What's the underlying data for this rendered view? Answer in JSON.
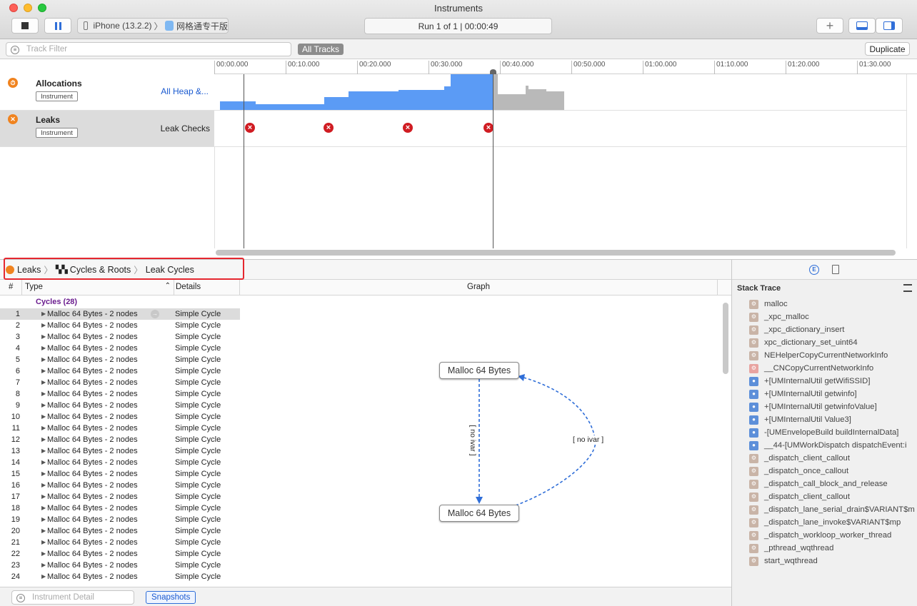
{
  "window": {
    "title": "Instruments"
  },
  "toolbar": {
    "device_name": "iPhone (13.2.2)",
    "app_name": "网格通专干版",
    "run_status": "Run 1 of 1  |  00:00:49"
  },
  "filterbar": {
    "track_filter_placeholder": "Track Filter",
    "all_tracks_label": "All Tracks",
    "duplicate_label": "Duplicate"
  },
  "ruler": {
    "ticks": [
      "00:00.000",
      "00:10.000",
      "00:20.000",
      "00:30.000",
      "00:40.000",
      "00:50.000",
      "01:00.000",
      "01:10.000",
      "01:20.000",
      "01:30.000"
    ]
  },
  "tracks": [
    {
      "name": "Allocations",
      "badge": "Instrument",
      "detail": "All Heap &..."
    },
    {
      "name": "Leaks",
      "badge": "Instrument",
      "detail": "Leak Checks"
    }
  ],
  "breadcrumb": {
    "items": [
      "Leaks",
      "Cycles & Roots",
      "Leak Cycles"
    ]
  },
  "columns": {
    "num": "#",
    "type": "Type",
    "details": "Details",
    "graph": "Graph"
  },
  "cycles": {
    "group_label": "Cycles (28)",
    "rows": [
      {
        "n": "1",
        "type": "Malloc 64 Bytes - 2 nodes",
        "details": "Simple Cycle"
      },
      {
        "n": "2",
        "type": "Malloc 64 Bytes - 2 nodes",
        "details": "Simple Cycle"
      },
      {
        "n": "3",
        "type": "Malloc 64 Bytes - 2 nodes",
        "details": "Simple Cycle"
      },
      {
        "n": "4",
        "type": "Malloc 64 Bytes - 2 nodes",
        "details": "Simple Cycle"
      },
      {
        "n": "5",
        "type": "Malloc 64 Bytes - 2 nodes",
        "details": "Simple Cycle"
      },
      {
        "n": "6",
        "type": "Malloc 64 Bytes - 2 nodes",
        "details": "Simple Cycle"
      },
      {
        "n": "7",
        "type": "Malloc 64 Bytes - 2 nodes",
        "details": "Simple Cycle"
      },
      {
        "n": "8",
        "type": "Malloc 64 Bytes - 2 nodes",
        "details": "Simple Cycle"
      },
      {
        "n": "9",
        "type": "Malloc 64 Bytes - 2 nodes",
        "details": "Simple Cycle"
      },
      {
        "n": "10",
        "type": "Malloc 64 Bytes - 2 nodes",
        "details": "Simple Cycle"
      },
      {
        "n": "11",
        "type": "Malloc 64 Bytes - 2 nodes",
        "details": "Simple Cycle"
      },
      {
        "n": "12",
        "type": "Malloc 64 Bytes - 2 nodes",
        "details": "Simple Cycle"
      },
      {
        "n": "13",
        "type": "Malloc 64 Bytes - 2 nodes",
        "details": "Simple Cycle"
      },
      {
        "n": "14",
        "type": "Malloc 64 Bytes - 2 nodes",
        "details": "Simple Cycle"
      },
      {
        "n": "15",
        "type": "Malloc 64 Bytes - 2 nodes",
        "details": "Simple Cycle"
      },
      {
        "n": "16",
        "type": "Malloc 64 Bytes - 2 nodes",
        "details": "Simple Cycle"
      },
      {
        "n": "17",
        "type": "Malloc 64 Bytes - 2 nodes",
        "details": "Simple Cycle"
      },
      {
        "n": "18",
        "type": "Malloc 64 Bytes - 2 nodes",
        "details": "Simple Cycle"
      },
      {
        "n": "19",
        "type": "Malloc 64 Bytes - 2 nodes",
        "details": "Simple Cycle"
      },
      {
        "n": "20",
        "type": "Malloc 64 Bytes - 2 nodes",
        "details": "Simple Cycle"
      },
      {
        "n": "21",
        "type": "Malloc 64 Bytes - 2 nodes",
        "details": "Simple Cycle"
      },
      {
        "n": "22",
        "type": "Malloc 64 Bytes - 2 nodes",
        "details": "Simple Cycle"
      },
      {
        "n": "23",
        "type": "Malloc 64 Bytes - 2 nodes",
        "details": "Simple Cycle"
      },
      {
        "n": "24",
        "type": "Malloc 64 Bytes - 2 nodes",
        "details": "Simple Cycle"
      }
    ]
  },
  "graph": {
    "node_top": "Malloc 64 Bytes",
    "node_bottom": "Malloc 64 Bytes",
    "edge_label_left": "[ no ivar ]",
    "edge_label_right": "[ no ivar ]"
  },
  "footer": {
    "instrument_detail_placeholder": "Instrument Detail",
    "snapshots_label": "Snapshots"
  },
  "stack_trace": {
    "title": "Stack Trace",
    "frames": [
      {
        "name": "malloc",
        "kind": "sys"
      },
      {
        "name": "_xpc_malloc",
        "kind": "sys"
      },
      {
        "name": "_xpc_dictionary_insert",
        "kind": "sys"
      },
      {
        "name": "xpc_dictionary_set_uint64",
        "kind": "sys"
      },
      {
        "name": "NEHelperCopyCurrentNetworkInfo",
        "kind": "sys"
      },
      {
        "name": "__CNCopyCurrentNetworkInfo",
        "kind": "lib"
      },
      {
        "name": "+[UMInternalUtil getWifiSSID]",
        "kind": "user"
      },
      {
        "name": "+[UMInternalUtil getwinfo]",
        "kind": "user"
      },
      {
        "name": "+[UMInternalUtil getwinfoValue]",
        "kind": "user"
      },
      {
        "name": "+[UMInternalUtil Value3]",
        "kind": "user"
      },
      {
        "name": "-[UMEnvelopeBuild buildInternalData]",
        "kind": "user"
      },
      {
        "name": "__44-[UMWorkDispatch dispatchEvent:i",
        "kind": "user"
      },
      {
        "name": "_dispatch_client_callout",
        "kind": "sys"
      },
      {
        "name": "_dispatch_once_callout",
        "kind": "sys"
      },
      {
        "name": "_dispatch_call_block_and_release",
        "kind": "sys"
      },
      {
        "name": "_dispatch_client_callout",
        "kind": "sys"
      },
      {
        "name": "_dispatch_lane_serial_drain$VARIANT$m",
        "kind": "sys"
      },
      {
        "name": "_dispatch_lane_invoke$VARIANT$mp",
        "kind": "sys"
      },
      {
        "name": "_dispatch_workloop_worker_thread",
        "kind": "sys"
      },
      {
        "name": "_pthread_wqthread",
        "kind": "sys"
      },
      {
        "name": "start_wqthread",
        "kind": "sys"
      }
    ]
  },
  "colors": {
    "accent": "#2f6ed8",
    "allocation_fill": "#5b9bf5",
    "allocation_future": "#b9b9b9",
    "leak_red": "#d01c22",
    "highlight_box": "#e5272f",
    "cycle_label": "#6b1d8f"
  }
}
